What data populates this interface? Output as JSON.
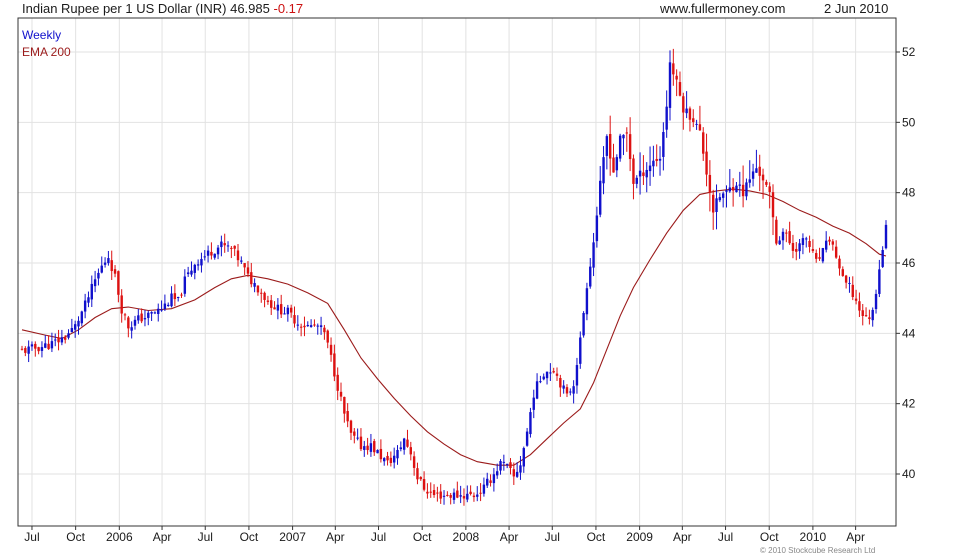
{
  "header": {
    "title": "Indian Rupee per 1 US Dollar (INR) 46.985",
    "change": "-0.17",
    "source": "www.fullermoney.com",
    "date": "2 Jun 2010"
  },
  "footer": {
    "copyright": "© 2010 Stockcube Research Ltd"
  },
  "colors": {
    "up": "#1010cc",
    "down": "#dd1111",
    "ema": "#9b1b1b",
    "grid": "#e2e2e2",
    "axis": "#333333"
  },
  "chart_data": {
    "type": "line",
    "frequency": "weekly",
    "ylim": [
      38.6,
      52.6
    ],
    "yticks": [
      40,
      42,
      44,
      46,
      48,
      50,
      52
    ],
    "x_range": [
      "2005-06-10",
      "2010-06-04"
    ],
    "xticks": [
      {
        "label": "Jul",
        "date": "2005-07-01"
      },
      {
        "label": "Oct",
        "date": "2005-10-01"
      },
      {
        "label": "2006",
        "date": "2006-01-01"
      },
      {
        "label": "Apr",
        "date": "2006-04-01"
      },
      {
        "label": "Jul",
        "date": "2006-07-01"
      },
      {
        "label": "Oct",
        "date": "2006-10-01"
      },
      {
        "label": "2007",
        "date": "2007-01-01"
      },
      {
        "label": "Apr",
        "date": "2007-04-01"
      },
      {
        "label": "Jul",
        "date": "2007-07-01"
      },
      {
        "label": "Oct",
        "date": "2007-10-01"
      },
      {
        "label": "2008",
        "date": "2008-01-01"
      },
      {
        "label": "Apr",
        "date": "2008-04-01"
      },
      {
        "label": "Jul",
        "date": "2008-07-01"
      },
      {
        "label": "Oct",
        "date": "2008-10-01"
      },
      {
        "label": "2009",
        "date": "2009-01-01"
      },
      {
        "label": "Apr",
        "date": "2009-04-01"
      },
      {
        "label": "Jul",
        "date": "2009-07-01"
      },
      {
        "label": "Oct",
        "date": "2009-10-01"
      },
      {
        "label": "2010",
        "date": "2010-01-01"
      },
      {
        "label": "Apr",
        "date": "2010-04-01"
      }
    ],
    "grid": true,
    "series": [
      {
        "name": "Weekly",
        "style": "candlestick",
        "anchors": [
          [
            "2005-06-10",
            43.5
          ],
          [
            "2005-07-15",
            43.6
          ],
          [
            "2005-08-12",
            43.7
          ],
          [
            "2005-09-09",
            43.9
          ],
          [
            "2005-09-30",
            44.2
          ],
          [
            "2005-10-21",
            44.8
          ],
          [
            "2005-11-11",
            45.5
          ],
          [
            "2005-11-25",
            45.9
          ],
          [
            "2005-12-09",
            46.2
          ],
          [
            "2005-12-23",
            45.6
          ],
          [
            "2006-01-06",
            44.7
          ],
          [
            "2006-01-20",
            44.2
          ],
          [
            "2006-02-10",
            44.4
          ],
          [
            "2006-03-03",
            44.5
          ],
          [
            "2006-03-31",
            44.7
          ],
          [
            "2006-04-21",
            45.0
          ],
          [
            "2006-05-05",
            44.9
          ],
          [
            "2006-05-19",
            45.5
          ],
          [
            "2006-06-09",
            46.0
          ],
          [
            "2006-06-30",
            46.2
          ],
          [
            "2006-07-21",
            46.4
          ],
          [
            "2006-08-04",
            46.5
          ],
          [
            "2006-08-25",
            46.4
          ],
          [
            "2006-09-15",
            46.0
          ],
          [
            "2006-09-29",
            45.6
          ],
          [
            "2006-10-20",
            45.3
          ],
          [
            "2006-11-10",
            44.9
          ],
          [
            "2006-12-01",
            44.7
          ],
          [
            "2006-12-22",
            44.6
          ],
          [
            "2007-01-12",
            44.3
          ],
          [
            "2007-02-02",
            44.2
          ],
          [
            "2007-02-23",
            44.2
          ],
          [
            "2007-03-09",
            44.0
          ],
          [
            "2007-03-23",
            43.3
          ],
          [
            "2007-04-06",
            42.5
          ],
          [
            "2007-04-20",
            41.7
          ],
          [
            "2007-05-04",
            41.1
          ],
          [
            "2007-05-25",
            40.8
          ],
          [
            "2007-06-15",
            40.8
          ],
          [
            "2007-07-06",
            40.5
          ],
          [
            "2007-07-20",
            40.3
          ],
          [
            "2007-08-10",
            40.6
          ],
          [
            "2007-08-24",
            41.0
          ],
          [
            "2007-09-07",
            40.6
          ],
          [
            "2007-09-21",
            39.9
          ],
          [
            "2007-10-05",
            39.6
          ],
          [
            "2007-10-26",
            39.4
          ],
          [
            "2007-11-16",
            39.4
          ],
          [
            "2007-12-07",
            39.4
          ],
          [
            "2007-12-28",
            39.4
          ],
          [
            "2008-01-18",
            39.4
          ],
          [
            "2008-02-08",
            39.6
          ],
          [
            "2008-02-29",
            40.0
          ],
          [
            "2008-03-14",
            40.3
          ],
          [
            "2008-03-28",
            40.2
          ],
          [
            "2008-04-11",
            39.9
          ],
          [
            "2008-04-25",
            40.3
          ],
          [
            "2008-05-09",
            41.2
          ],
          [
            "2008-05-23",
            42.3
          ],
          [
            "2008-06-13",
            42.9
          ],
          [
            "2008-07-04",
            43.0
          ],
          [
            "2008-07-18",
            42.6
          ],
          [
            "2008-08-01",
            42.2
          ],
          [
            "2008-08-15",
            42.6
          ],
          [
            "2008-08-29",
            43.8
          ],
          [
            "2008-09-12",
            45.4
          ],
          [
            "2008-09-26",
            46.6
          ],
          [
            "2008-10-10",
            48.2
          ],
          [
            "2008-10-24",
            49.6
          ],
          [
            "2008-11-07",
            48.6
          ],
          [
            "2008-11-21",
            49.5
          ],
          [
            "2008-12-05",
            49.7
          ],
          [
            "2008-12-19",
            48.3
          ],
          [
            "2009-01-09",
            48.6
          ],
          [
            "2009-01-30",
            48.9
          ],
          [
            "2009-02-13",
            49.0
          ],
          [
            "2009-02-27",
            50.5
          ],
          [
            "2009-03-06",
            51.7
          ],
          [
            "2009-03-20",
            51.1
          ],
          [
            "2009-04-03",
            50.4
          ],
          [
            "2009-04-24",
            50.1
          ],
          [
            "2009-05-08",
            49.7
          ],
          [
            "2009-05-22",
            48.6
          ],
          [
            "2009-06-05",
            47.5
          ],
          [
            "2009-06-19",
            47.9
          ],
          [
            "2009-07-03",
            48.0
          ],
          [
            "2009-07-24",
            48.3
          ],
          [
            "2009-08-07",
            48.0
          ],
          [
            "2009-08-21",
            48.4
          ],
          [
            "2009-09-04",
            48.7
          ],
          [
            "2009-09-18",
            48.4
          ],
          [
            "2009-10-02",
            47.9
          ],
          [
            "2009-10-16",
            46.6
          ],
          [
            "2009-10-30",
            46.9
          ],
          [
            "2009-11-20",
            46.4
          ],
          [
            "2009-12-04",
            46.5
          ],
          [
            "2009-12-18",
            46.7
          ],
          [
            "2010-01-08",
            46.0
          ],
          [
            "2010-01-22",
            46.3
          ],
          [
            "2010-02-05",
            46.7
          ],
          [
            "2010-02-19",
            46.2
          ],
          [
            "2010-03-05",
            45.5
          ],
          [
            "2010-03-19",
            45.3
          ],
          [
            "2010-04-09",
            44.7
          ],
          [
            "2010-04-23",
            44.4
          ],
          [
            "2010-05-07",
            44.6
          ],
          [
            "2010-05-21",
            45.9
          ],
          [
            "2010-06-04",
            46.98
          ]
        ]
      },
      {
        "name": "EMA 200",
        "style": "line",
        "points": [
          [
            "2005-06-10",
            44.1
          ],
          [
            "2005-07-29",
            43.95
          ],
          [
            "2005-09-02",
            43.85
          ],
          [
            "2005-10-07",
            44.1
          ],
          [
            "2005-11-11",
            44.45
          ],
          [
            "2005-12-16",
            44.7
          ],
          [
            "2006-01-20",
            44.75
          ],
          [
            "2006-03-03",
            44.65
          ],
          [
            "2006-04-21",
            44.7
          ],
          [
            "2006-06-09",
            44.95
          ],
          [
            "2006-07-21",
            45.3
          ],
          [
            "2006-08-25",
            45.55
          ],
          [
            "2006-09-29",
            45.65
          ],
          [
            "2006-11-10",
            45.55
          ],
          [
            "2006-12-22",
            45.4
          ],
          [
            "2007-02-02",
            45.15
          ],
          [
            "2007-03-16",
            44.85
          ],
          [
            "2007-04-20",
            44.1
          ],
          [
            "2007-05-25",
            43.3
          ],
          [
            "2007-06-29",
            42.7
          ],
          [
            "2007-08-03",
            42.15
          ],
          [
            "2007-09-07",
            41.65
          ],
          [
            "2007-10-12",
            41.2
          ],
          [
            "2007-11-16",
            40.85
          ],
          [
            "2007-12-21",
            40.55
          ],
          [
            "2008-01-25",
            40.35
          ],
          [
            "2008-03-07",
            40.25
          ],
          [
            "2008-04-11",
            40.25
          ],
          [
            "2008-05-16",
            40.55
          ],
          [
            "2008-06-20",
            41.0
          ],
          [
            "2008-07-25",
            41.45
          ],
          [
            "2008-08-29",
            41.85
          ],
          [
            "2008-09-26",
            42.6
          ],
          [
            "2008-10-24",
            43.55
          ],
          [
            "2008-11-21",
            44.5
          ],
          [
            "2008-12-19",
            45.3
          ],
          [
            "2009-01-23",
            46.1
          ],
          [
            "2009-02-27",
            46.85
          ],
          [
            "2009-04-03",
            47.5
          ],
          [
            "2009-05-08",
            47.95
          ],
          [
            "2009-06-12",
            48.05
          ],
          [
            "2009-07-17",
            48.1
          ],
          [
            "2009-08-21",
            48.05
          ],
          [
            "2009-09-25",
            47.95
          ],
          [
            "2009-10-30",
            47.75
          ],
          [
            "2009-12-04",
            47.5
          ],
          [
            "2010-01-08",
            47.3
          ],
          [
            "2010-02-12",
            47.05
          ],
          [
            "2010-03-19",
            46.85
          ],
          [
            "2010-04-23",
            46.55
          ],
          [
            "2010-05-21",
            46.25
          ],
          [
            "2010-06-04",
            46.2
          ]
        ]
      }
    ]
  }
}
